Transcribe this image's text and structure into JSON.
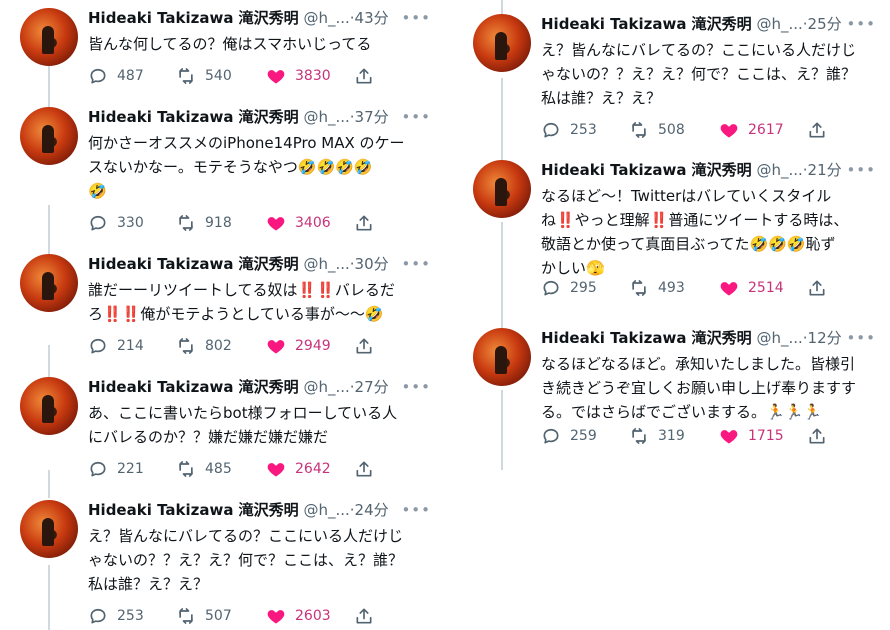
{
  "left_column": [
    {
      "name": "Hideaki Takizawa 滝沢秀明",
      "handle": "@h_...",
      "dot": "·",
      "time": "43分",
      "text": "皆んな何してるの？俺はスマホいじってる",
      "replies": "487",
      "retweets": "540",
      "likes": "3830"
    },
    {
      "name": "Hideaki Takizawa 滝沢秀明",
      "handle": "@h_...",
      "dot": "·",
      "time": "37分",
      "text": "何かさーオススメのiPhone14Pro MAX のケー\nスないかなー。モテそうなやつ🤣🤣🤣🤣\n🤣",
      "replies": "330",
      "retweets": "918",
      "likes": "3406"
    },
    {
      "name": "Hideaki Takizawa 滝沢秀明",
      "handle": "@h_...",
      "dot": "·",
      "time": "30分",
      "text": "誰だーーリツイートしてる奴は‼️‼️バレるだ\nろ‼️‼️俺がモテようとしている事が〜〜🤣",
      "replies": "214",
      "retweets": "802",
      "likes": "2949"
    },
    {
      "name": "Hideaki Takizawa 滝沢秀明",
      "handle": "@h_...",
      "dot": "·",
      "time": "27分",
      "text": "あ、ここに書いたらbot様フォローしている人\nにバレるのか？？嫌だ嫌だ嫌だ嫌だ",
      "replies": "221",
      "retweets": "485",
      "likes": "2642"
    },
    {
      "name": "Hideaki Takizawa 滝沢秀明",
      "handle": "@h_...",
      "dot": "·",
      "time": "24分",
      "text": "え？皆んなにバレてるの？ここにいる人だけじ\nゃないの？？え？え？何で？ここは、え？誰？\n私は誰？え？え？",
      "replies": "253",
      "retweets": "507",
      "likes": "2603"
    }
  ],
  "right_column": [
    {
      "name": "Hideaki Takizawa 滝沢秀明",
      "handle": "@h_...",
      "dot": "·",
      "time": "25分",
      "text": "え？皆んなにバレてるの？ここにいる人だけじ\nゃないの？？え？え？何で？ここは、え？誰？\n私は誰？え？え？",
      "replies": "253",
      "retweets": "508",
      "likes": "2617"
    },
    {
      "name": "Hideaki Takizawa 滝沢秀明",
      "handle": "@h_...",
      "dot": "·",
      "time": "21分",
      "text": "なるほど〜！Twitterはバレていくスタイル\nね‼️やっと理解‼️普通にツイートする時は、\n敬語とか使って真面目ぶってた🤣🤣🤣恥ず\nかしい🫣",
      "replies": "295",
      "retweets": "493",
      "likes": "2514"
    },
    {
      "name": "Hideaki Takizawa 滝沢秀明",
      "handle": "@h_...",
      "dot": "·",
      "time": "12分",
      "text": "なるほどなるほど。承知いたしました。皆様引\nき続きどうぞ宜しくお願い申し上げ奉りますす\nる。ではさらばでございまする。🏃🏃🏃",
      "replies": "259",
      "retweets": "319",
      "likes": "1715"
    }
  ],
  "colors": {
    "like": "#f91880",
    "icon": "#536471",
    "thread_line": "#cfd9de"
  }
}
